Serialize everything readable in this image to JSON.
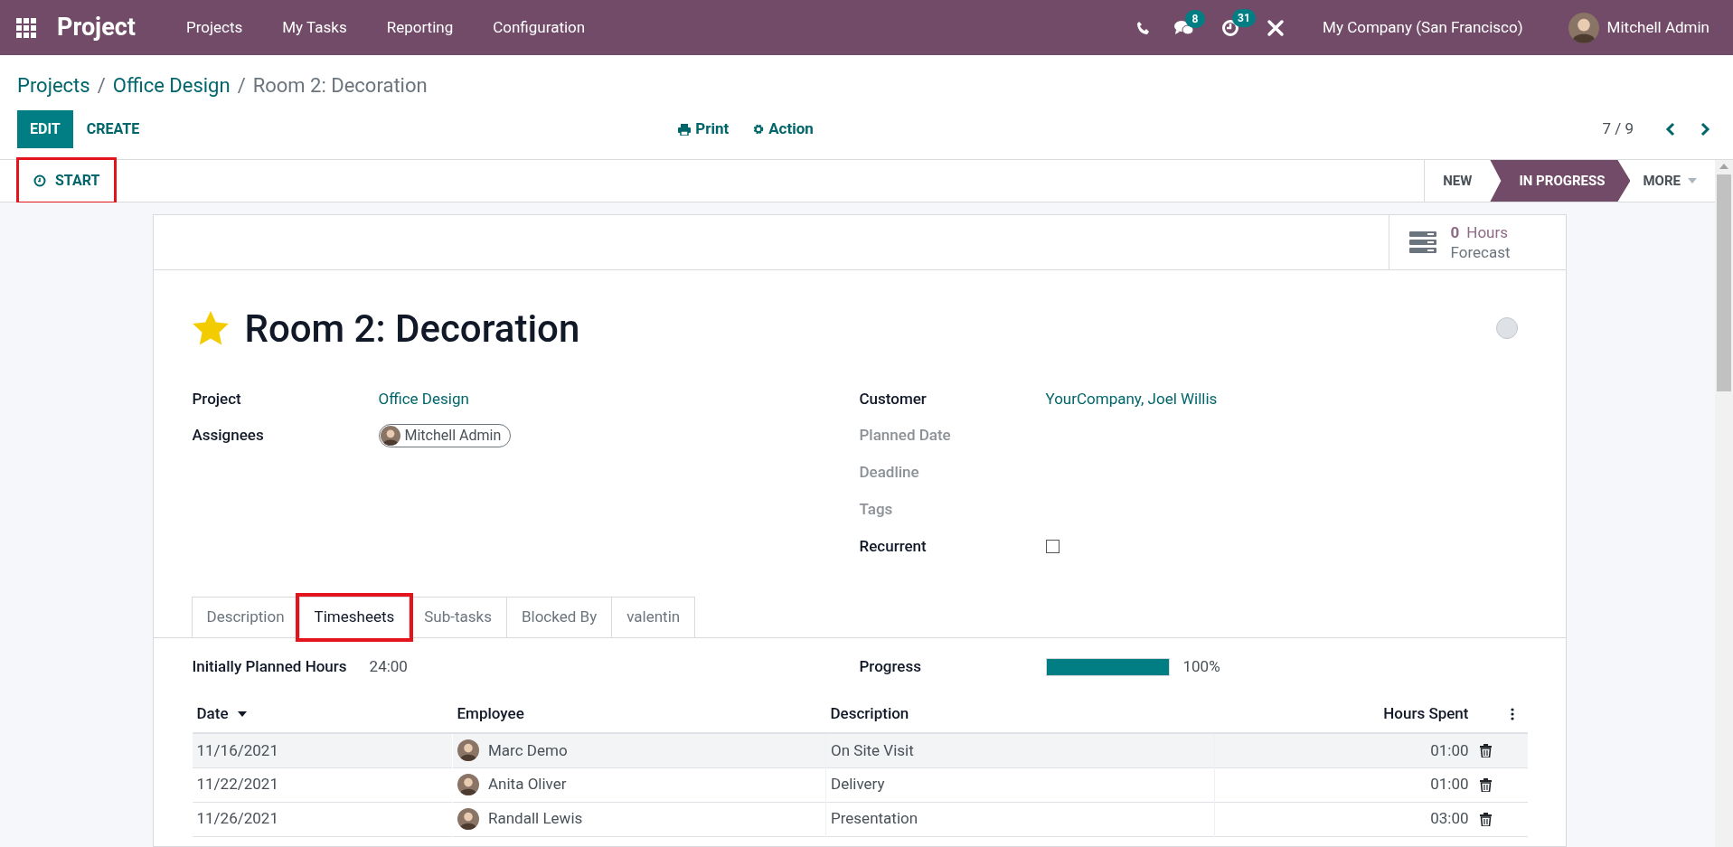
{
  "navbar": {
    "app_title": "Project",
    "menu": [
      "Projects",
      "My Tasks",
      "Reporting",
      "Configuration"
    ],
    "badges": [
      {
        "kind": "chat",
        "count": "8"
      },
      {
        "kind": "activity",
        "count": "31"
      }
    ],
    "company": "My Company (San Francisco)",
    "user": "Mitchell Admin"
  },
  "breadcrumb": [
    {
      "label": "Projects",
      "link": true
    },
    {
      "separator": "/",
      "label": "Office Design",
      "link": true
    },
    {
      "separator": "/",
      "label": "Room 2: Decoration",
      "link": false
    }
  ],
  "buttons": [
    {
      "label": "EDIT",
      "primary": true
    },
    {
      "label": "CREATE",
      "primary": false
    }
  ],
  "actions": [
    {
      "kind": "print",
      "label": "Print"
    },
    {
      "kind": "action",
      "label": "Action"
    }
  ],
  "pager": {
    "text": "7 / 9"
  },
  "start_button": {
    "label": "START",
    "highlighted": true
  },
  "stages": [
    {
      "label": "NEW",
      "selected": false
    },
    {
      "label": "IN PROGRESS",
      "selected": true
    }
  ],
  "more_stages": "MORE",
  "smart_button": {
    "value": "0",
    "unit": "Hours",
    "label": "Forecast"
  },
  "task": {
    "title": "Room 2: Decoration",
    "starred": true
  },
  "left_fields": [
    {
      "label": "Project",
      "kind": "link",
      "value": "Office Design"
    },
    {
      "label": "Assignees",
      "kind": "tag",
      "value": "Mitchell Admin"
    }
  ],
  "right_fields": [
    {
      "label": "Customer",
      "kind": "link",
      "value": "YourCompany, Joel Willis"
    },
    {
      "label": "Planned Date",
      "kind": "empty"
    },
    {
      "label": "Deadline",
      "kind": "empty"
    },
    {
      "label": "Tags",
      "kind": "empty"
    },
    {
      "label": "Recurrent",
      "kind": "checkbox",
      "checked": false
    }
  ],
  "tabs": [
    {
      "label": "Description",
      "selected": false,
      "highlighted": false
    },
    {
      "label": "Timesheets",
      "selected": true,
      "highlighted": true
    },
    {
      "label": "Sub-tasks",
      "selected": false,
      "highlighted": false
    },
    {
      "label": "Blocked By",
      "selected": false,
      "highlighted": false
    },
    {
      "label": "valentin",
      "selected": false,
      "highlighted": false
    }
  ],
  "summary": {
    "planned_label": "Initially Planned Hours",
    "planned_value": "24:00",
    "progress_label": "Progress",
    "level": 1.0,
    "progress_text": "100%"
  },
  "timesheet": {
    "columns": [
      {
        "label": "Date",
        "sorted": true,
        "kind": "text"
      },
      {
        "label": "Employee",
        "sorted": false,
        "kind": "text"
      },
      {
        "label": "Description",
        "sorted": false,
        "kind": "text"
      },
      {
        "label": "Hours Spent",
        "sorted": false,
        "kind": "number"
      }
    ],
    "rows": [
      {
        "date": "11/16/2021",
        "employee": "Marc Demo",
        "description": "On Site Visit",
        "hours": "01:00"
      },
      {
        "date": "11/22/2021",
        "employee": "Anita Oliver",
        "description": "Delivery",
        "hours": "01:00"
      },
      {
        "date": "11/26/2021",
        "employee": "Randall Lewis",
        "description": "Presentation",
        "hours": "03:00"
      }
    ]
  }
}
